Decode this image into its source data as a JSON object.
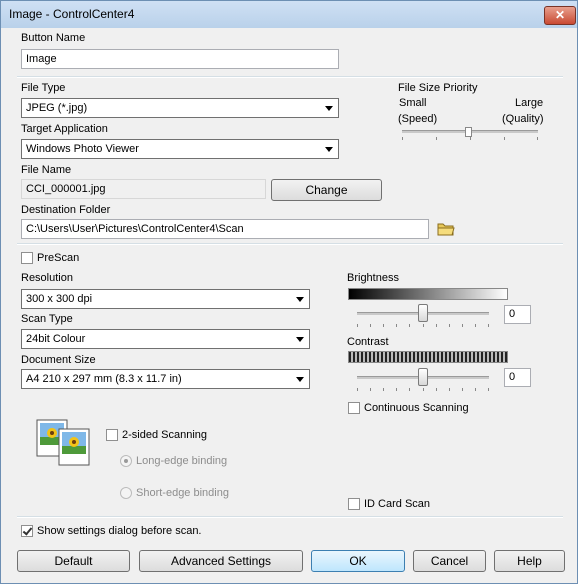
{
  "window": {
    "title": "Image - ControlCenter4",
    "close_glyph": "✕"
  },
  "button_name": {
    "label": "Button Name",
    "value": "Image"
  },
  "file_type": {
    "label": "File Type",
    "value": "JPEG (*.jpg)"
  },
  "file_size_priority": {
    "label": "File Size Priority",
    "small": "Small",
    "large": "Large",
    "speed": "(Speed)",
    "quality": "(Quality)"
  },
  "target_application": {
    "label": "Target Application",
    "value": "Windows Photo Viewer"
  },
  "file_name": {
    "label": "File Name",
    "value": "CCI_000001.jpg",
    "change_button": "Change"
  },
  "destination_folder": {
    "label": "Destination Folder",
    "value": "C:\\Users\\User\\Pictures\\ControlCenter4\\Scan",
    "icon": "folder-icon"
  },
  "prescan": {
    "label": "PreScan",
    "checked": false
  },
  "resolution": {
    "label": "Resolution",
    "value": "300 x 300 dpi"
  },
  "scan_type": {
    "label": "Scan Type",
    "value": "24bit Colour"
  },
  "document_size": {
    "label": "Document Size",
    "value": "A4 210 x 297 mm (8.3 x 11.7 in)"
  },
  "brightness": {
    "label": "Brightness",
    "value": "0"
  },
  "contrast": {
    "label": "Contrast",
    "value": "0"
  },
  "continuous_scanning": {
    "label": "Continuous Scanning",
    "checked": false
  },
  "two_sided": {
    "label": "2-sided Scanning",
    "checked": false,
    "long_edge": "Long-edge binding",
    "short_edge": "Short-edge binding",
    "icon": "duplex-photos-icon"
  },
  "id_card_scan": {
    "label": "ID Card Scan",
    "checked": false
  },
  "show_settings": {
    "label": "Show settings dialog before scan.",
    "checked": true
  },
  "buttons": {
    "default": "Default",
    "advanced": "Advanced Settings",
    "ok": "OK",
    "cancel": "Cancel",
    "help": "Help"
  }
}
